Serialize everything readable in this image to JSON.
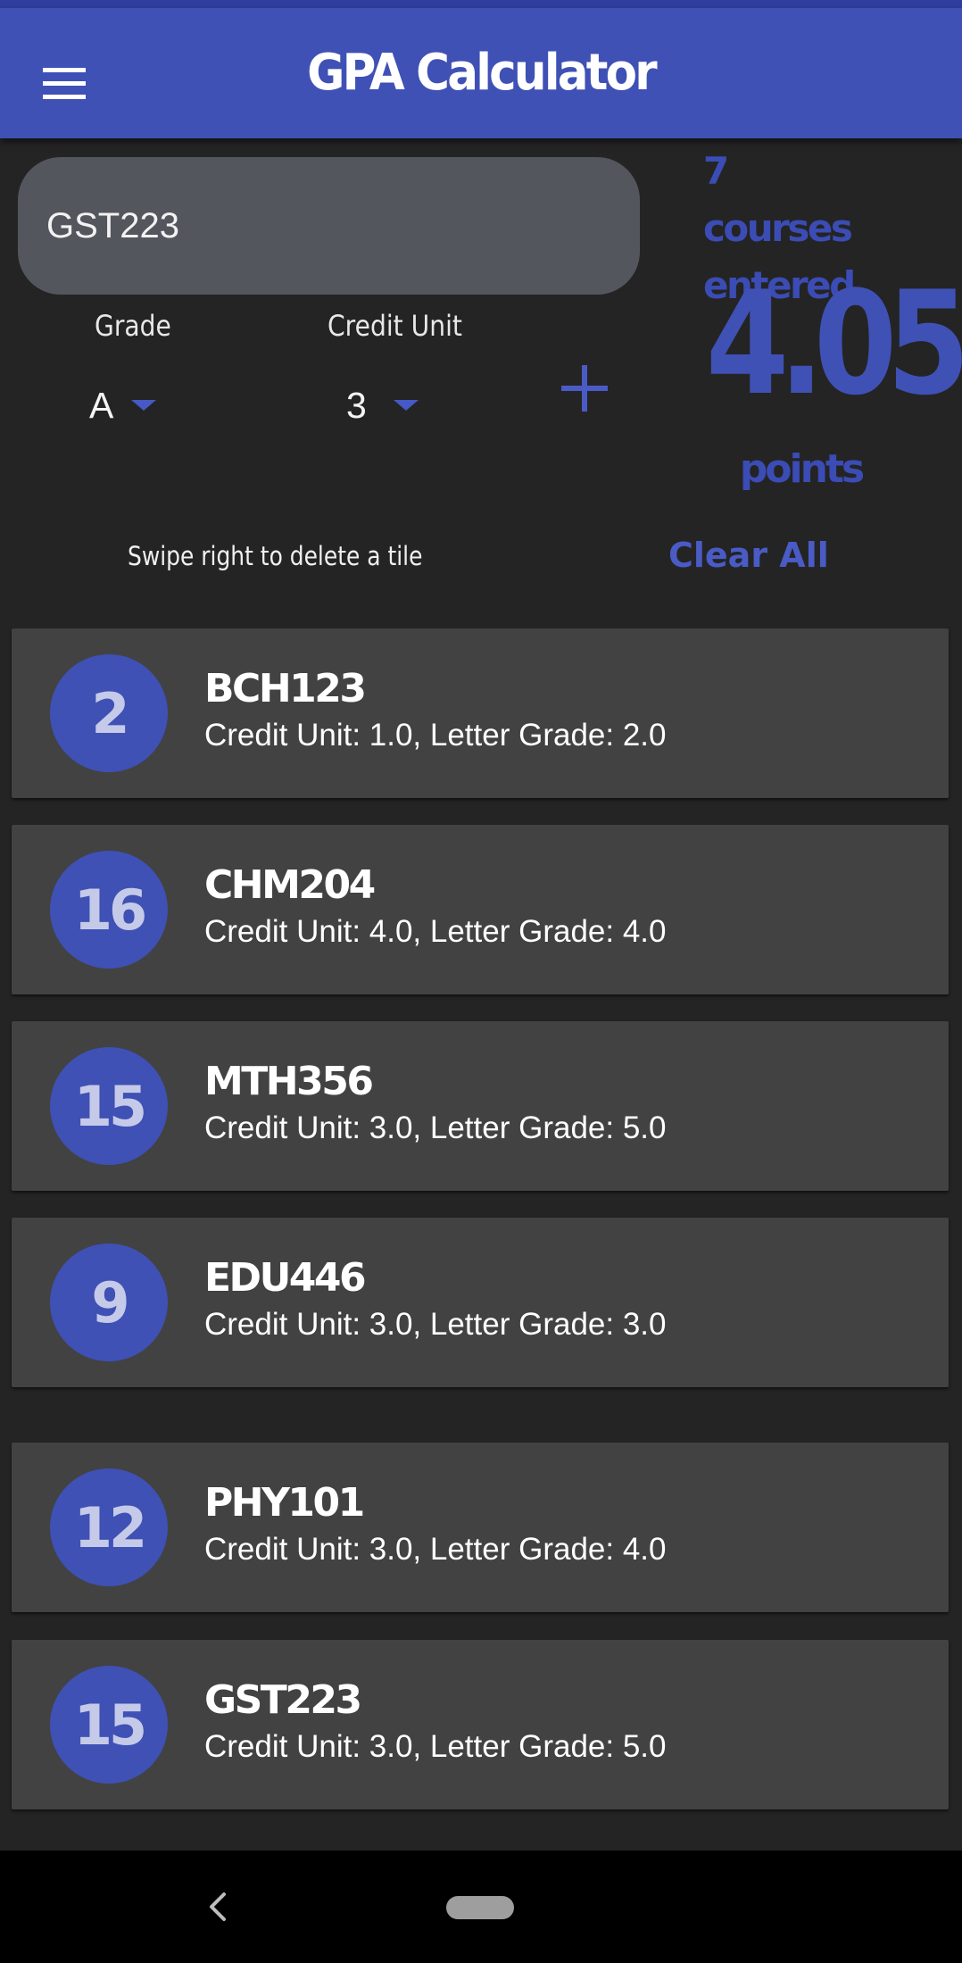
{
  "app_bar": {
    "title": "GPA Calculator"
  },
  "form": {
    "course_value": "GST223",
    "grade_label": "Grade",
    "grade_value": "A",
    "credit_label": "Credit Unit",
    "credit_value": "3"
  },
  "summary": {
    "courses_entered": "7 courses entered",
    "gpa": "4.05",
    "points_label": "points"
  },
  "hint": "Swipe right to delete a tile",
  "clear_all": "Clear All",
  "courses": [
    {
      "points": "2",
      "code": "BCH123",
      "detail": "Credit Unit: 1.0, Letter Grade: 2.0"
    },
    {
      "points": "16",
      "code": "CHM204",
      "detail": "Credit Unit: 4.0, Letter Grade: 4.0"
    },
    {
      "points": "15",
      "code": "MTH356",
      "detail": "Credit Unit: 3.0, Letter Grade: 5.0"
    },
    {
      "points": "9",
      "code": "EDU446",
      "detail": "Credit Unit: 3.0, Letter Grade: 3.0"
    },
    {
      "points": "12",
      "code": "PHY101",
      "detail": "Credit Unit: 3.0, Letter Grade: 4.0"
    },
    {
      "points": "15",
      "code": "GST223",
      "detail": "Credit Unit: 3.0, Letter Grade: 5.0"
    }
  ],
  "colors": {
    "primary": "#3f51b5",
    "background": "#242424",
    "tile": "#424242",
    "input": "#54565d"
  },
  "icons": {
    "menu": "hamburger-menu-icon",
    "add": "plus-icon",
    "dropdown": "caret-down-icon",
    "back": "chevron-left-icon",
    "home": "home-pill-icon"
  }
}
